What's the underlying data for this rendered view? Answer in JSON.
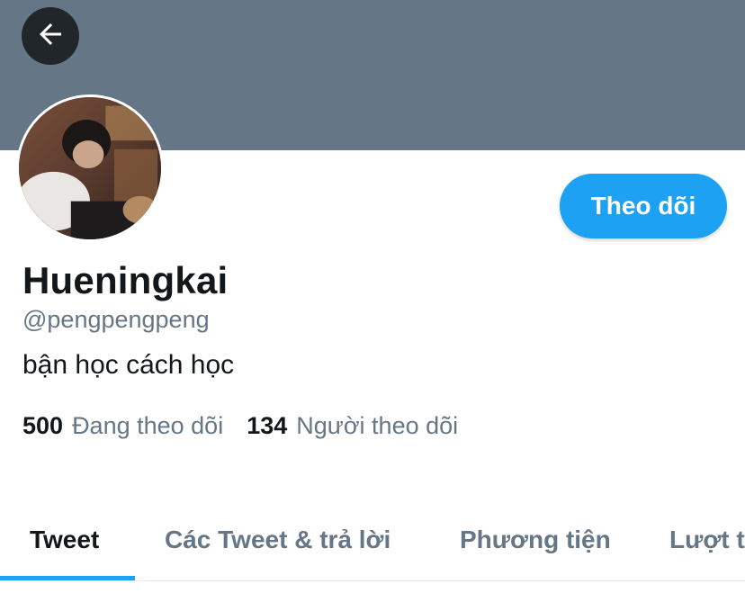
{
  "colors": {
    "banner": "#657786",
    "accent": "#1da1f2",
    "text_primary": "#14171a",
    "text_secondary": "#657786"
  },
  "header": {
    "back_icon": "arrow-left-icon"
  },
  "profile": {
    "display_name": "Hueningkai",
    "handle": "@pengpengpeng",
    "bio": "bận học cách học",
    "follow_button_label": "Theo dõi"
  },
  "stats": {
    "following_count": "500",
    "following_label": "Đang theo dõi",
    "followers_count": "134",
    "followers_label": "Người theo dõi"
  },
  "tabs": [
    {
      "label": "Tweet",
      "active": true
    },
    {
      "label": "Các Tweet & trả lời",
      "active": false
    },
    {
      "label": "Phương tiện",
      "active": false
    },
    {
      "label": "Lượt thích",
      "active": false
    }
  ]
}
